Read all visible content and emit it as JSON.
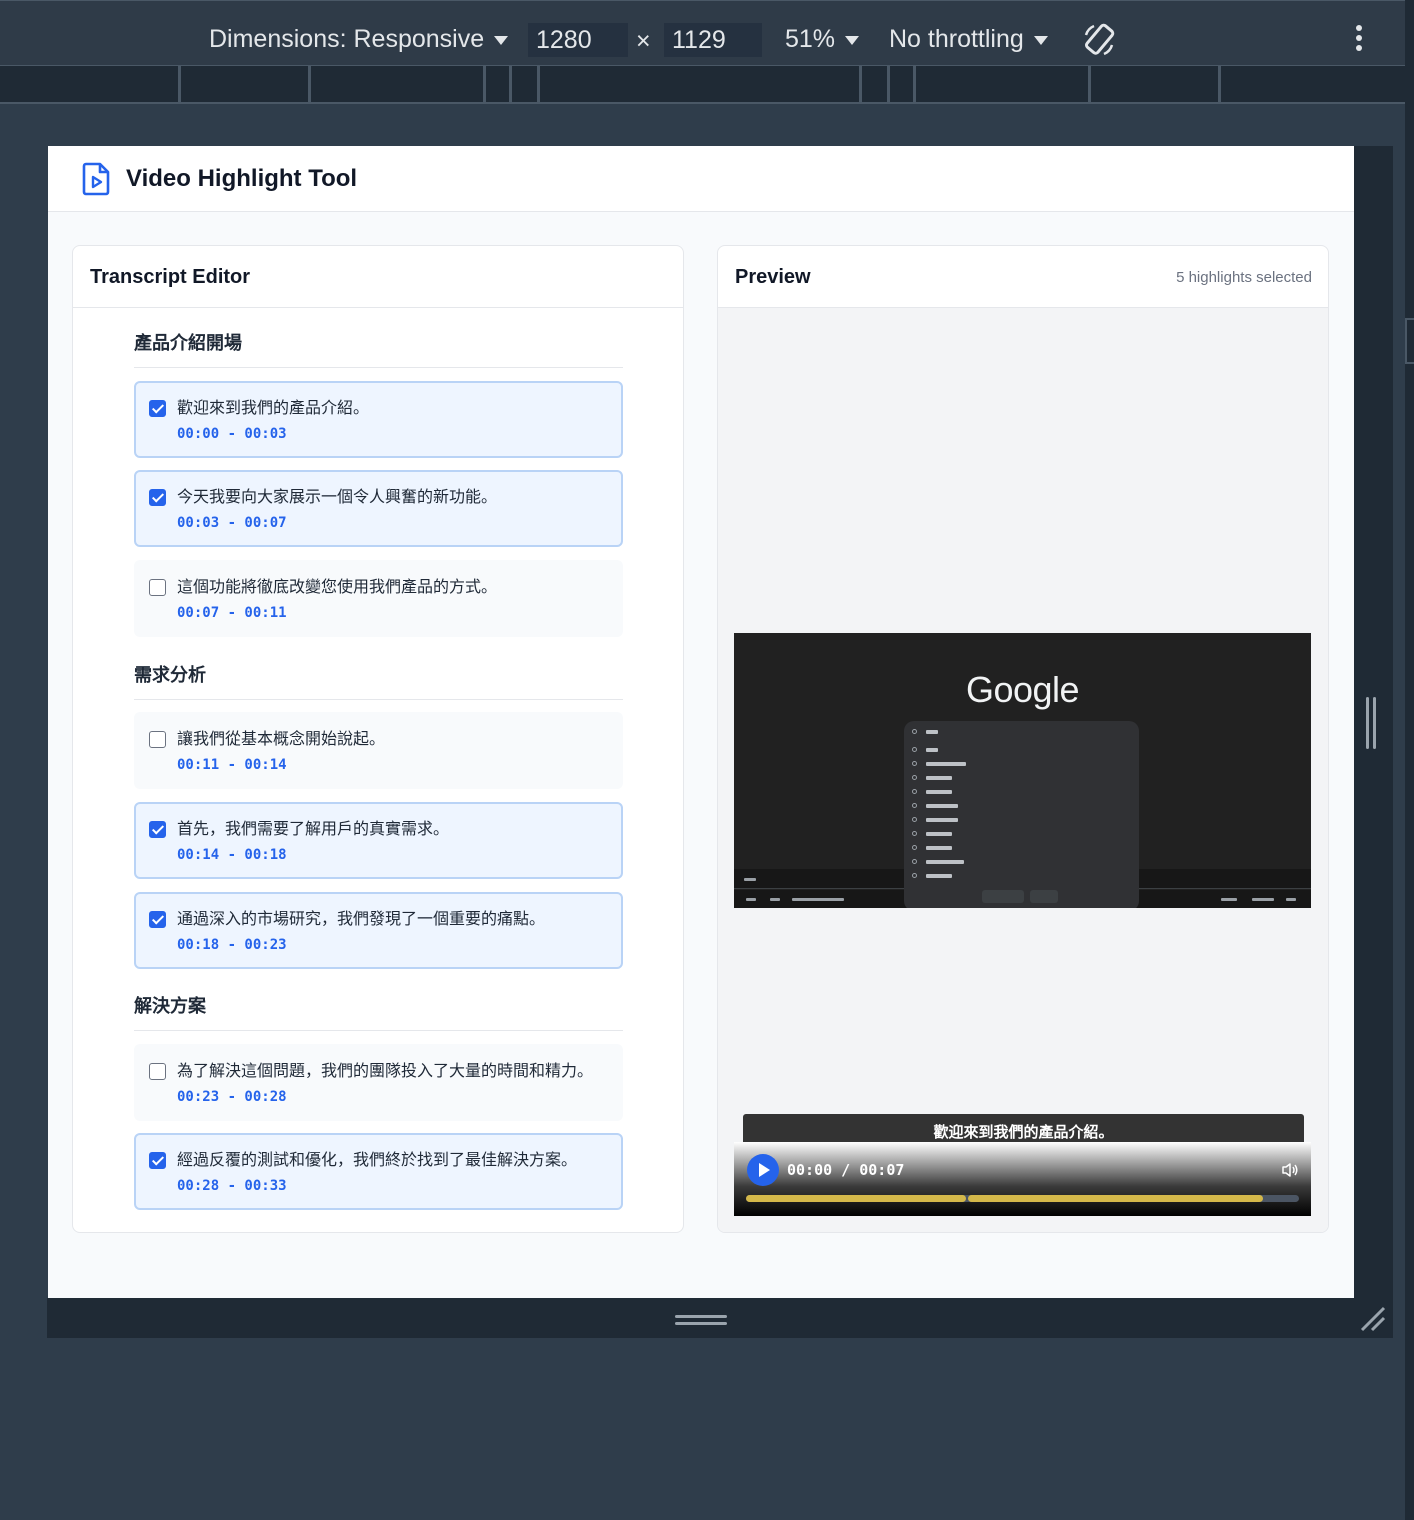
{
  "devtools": {
    "dimensions_label": "Dimensions: Responsive",
    "width": "1280",
    "height": "1129",
    "times": "×",
    "zoom": "51%",
    "throttling": "No throttling"
  },
  "app": {
    "title": "Video Highlight Tool"
  },
  "editor": {
    "title": "Transcript Editor",
    "sections": [
      {
        "title": "產品介紹開場",
        "segments": [
          {
            "text": "歡迎來到我們的產品介紹。",
            "time": "00:00 - 00:03",
            "selected": true
          },
          {
            "text": "今天我要向大家展示一個令人興奮的新功能。",
            "time": "00:03 - 00:07",
            "selected": true
          },
          {
            "text": "這個功能將徹底改變您使用我們產品的方式。",
            "time": "00:07 - 00:11",
            "selected": false
          }
        ]
      },
      {
        "title": "需求分析",
        "segments": [
          {
            "text": "讓我們從基本概念開始說起。",
            "time": "00:11 - 00:14",
            "selected": false
          },
          {
            "text": "首先，我們需要了解用戶的真實需求。",
            "time": "00:14 - 00:18",
            "selected": true
          },
          {
            "text": "通過深入的市場研究，我們發現了一個重要的痛點。",
            "time": "00:18 - 00:23",
            "selected": true
          }
        ]
      },
      {
        "title": "解決方案",
        "segments": [
          {
            "text": "為了解決這個問題，我們的團隊投入了大量的時間和精力。",
            "time": "00:23 - 00:28",
            "selected": false
          },
          {
            "text": "經過反覆的測試和優化，我們終於找到了最佳解決方案。",
            "time": "00:28 - 00:33",
            "selected": true
          }
        ]
      }
    ]
  },
  "preview": {
    "title": "Preview",
    "selected_count": "5 highlights selected",
    "video_brand": "Google",
    "caption": "歡迎來到我們的產品介紹。",
    "time_display": "00:00 / 00:07",
    "highlight_ranges_fraction": [
      [
        0,
        0.4
      ],
      [
        0.4,
        0.935
      ]
    ],
    "accent_color": "#2563eb",
    "highlight_color": "#d4b84a"
  }
}
